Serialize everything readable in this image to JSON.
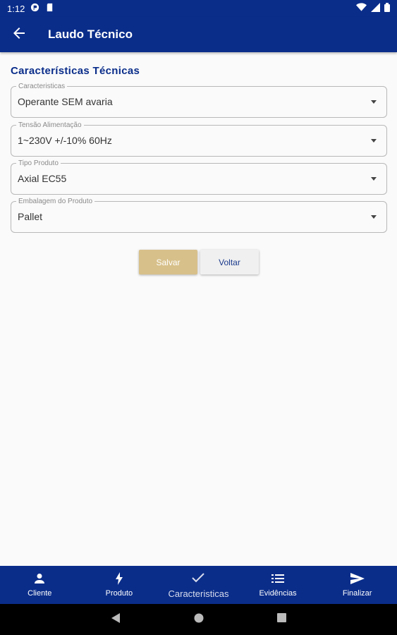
{
  "status_bar": {
    "time": "1:12"
  },
  "app_bar": {
    "title": "Laudo Técnico",
    "back_icon": "arrow-left-icon"
  },
  "section": {
    "title": "Características Técnicas"
  },
  "fields": [
    {
      "label": "Caracteristicas",
      "value": "Operante SEM avaria"
    },
    {
      "label": "Tensão Alimentação",
      "value": "1~230V +/-10% 60Hz"
    },
    {
      "label": "Tipo Produto",
      "value": "Axial EC55"
    },
    {
      "label": "Embalagem do Produto",
      "value": "Pallet"
    }
  ],
  "buttons": {
    "save_label": "Salvar",
    "back_label": "Voltar"
  },
  "bottom_nav": [
    {
      "label": "Cliente",
      "icon": "person-icon",
      "active": false
    },
    {
      "label": "Produto",
      "icon": "bolt-icon",
      "active": false
    },
    {
      "label": "Caracteristicas",
      "icon": "check-icon",
      "active": true
    },
    {
      "label": "Evidências",
      "icon": "list-icon",
      "active": false
    },
    {
      "label": "Finalizar",
      "icon": "send-icon",
      "active": false
    }
  ],
  "colors": {
    "primary": "#0a2d8a",
    "save_button": "#d7c08a",
    "section_title": "#0a2d8a"
  }
}
